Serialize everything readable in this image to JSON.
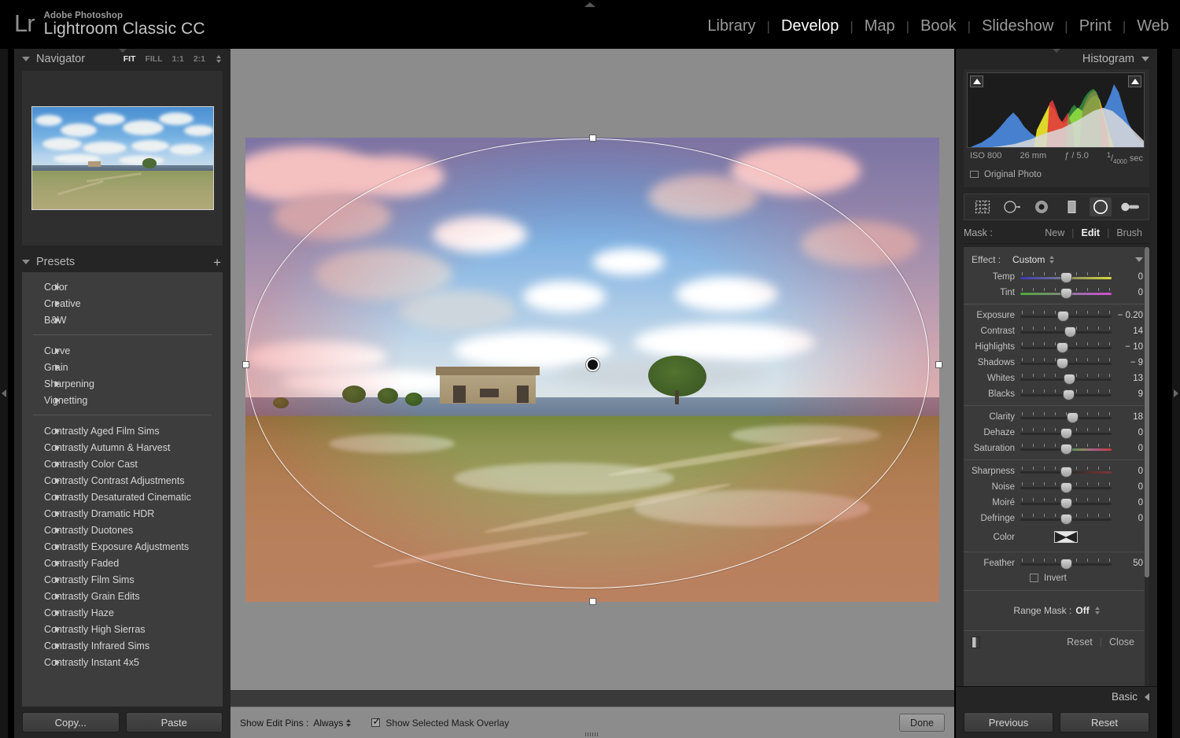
{
  "app": {
    "logo": "Lr",
    "brand_sub": "Adobe Photoshop",
    "brand_main": "Lightroom Classic CC"
  },
  "modules": [
    {
      "label": "Library",
      "active": false
    },
    {
      "label": "Develop",
      "active": true
    },
    {
      "label": "Map",
      "active": false
    },
    {
      "label": "Book",
      "active": false
    },
    {
      "label": "Slideshow",
      "active": false
    },
    {
      "label": "Print",
      "active": false
    },
    {
      "label": "Web",
      "active": false
    }
  ],
  "navigator": {
    "title": "Navigator",
    "zoom_levels": [
      {
        "label": "FIT",
        "active": true
      },
      {
        "label": "FILL",
        "active": false
      },
      {
        "label": "1:1",
        "active": false
      },
      {
        "label": "2:1",
        "active": false
      }
    ]
  },
  "presets": {
    "title": "Presets",
    "add_label": "+",
    "groups": [
      [
        "Color",
        "Creative",
        "B&W"
      ],
      [
        "Curve",
        "Grain",
        "Sharpening",
        "Vignetting"
      ],
      [
        "Contrastly Aged Film Sims",
        "Contrastly Autumn & Harvest",
        "Contrastly Color Cast",
        "Contrastly Contrast Adjustments",
        "Contrastly Desaturated Cinematic",
        "Contrastly Dramatic HDR",
        "Contrastly Duotones",
        "Contrastly Exposure Adjustments",
        "Contrastly Faded",
        "Contrastly Film Sims",
        "Contrastly Grain Edits",
        "Contrastly Haze",
        "Contrastly High Sierras",
        "Contrastly Infrared Sims",
        "Contrastly Instant 4x5"
      ]
    ]
  },
  "left_footer": {
    "copy_label": "Copy...",
    "paste_label": "Paste"
  },
  "toolbar": {
    "show_edit_pins_label": "Show Edit Pins :",
    "show_edit_pins_value": "Always",
    "mask_overlay_label": "Show Selected Mask Overlay",
    "mask_overlay_checked": true,
    "done_label": "Done"
  },
  "histogram": {
    "title": "Histogram",
    "iso": "ISO 800",
    "focal": "26 mm",
    "aperture": "ƒ / 5.0",
    "shutter_num": "1",
    "shutter_den": "4000",
    "shutter_unit": "sec",
    "original_photo_label": "Original Photo",
    "original_photo_checked": false
  },
  "tools": [
    {
      "name": "crop-overlay-tool",
      "selected": false
    },
    {
      "name": "spot-removal-tool",
      "selected": false
    },
    {
      "name": "red-eye-tool",
      "selected": false
    },
    {
      "name": "graduated-filter-tool",
      "selected": false
    },
    {
      "name": "radial-filter-tool",
      "selected": true
    },
    {
      "name": "adjustment-brush-tool",
      "selected": false
    }
  ],
  "mask": {
    "label": "Mask :",
    "new_label": "New",
    "edit_label": "Edit",
    "brush_label": "Brush",
    "active": "Edit"
  },
  "effect": {
    "label": "Effect :",
    "value": "Custom"
  },
  "sliders": [
    {
      "label": "Temp",
      "value": "0",
      "pos": 50,
      "grad": "grad-temp"
    },
    {
      "label": "Tint",
      "value": "0",
      "pos": 50,
      "grad": "grad-tint"
    },
    {
      "label": "Exposure",
      "value": "− 0.20",
      "pos": 47,
      "grad": ""
    },
    {
      "label": "Contrast",
      "value": "14",
      "pos": 55,
      "grad": ""
    },
    {
      "label": "Highlights",
      "value": "− 10",
      "pos": 46,
      "grad": ""
    },
    {
      "label": "Shadows",
      "value": "− 9",
      "pos": 46,
      "grad": ""
    },
    {
      "label": "Whites",
      "value": "13",
      "pos": 54,
      "grad": ""
    },
    {
      "label": "Blacks",
      "value": "9",
      "pos": 53,
      "grad": ""
    },
    {
      "label": "Clarity",
      "value": "18",
      "pos": 57,
      "grad": ""
    },
    {
      "label": "Dehaze",
      "value": "0",
      "pos": 50,
      "grad": ""
    },
    {
      "label": "Saturation",
      "value": "0",
      "pos": 50,
      "grad": "grad-sat"
    },
    {
      "label": "Sharpness",
      "value": "0",
      "pos": 50,
      "grad": "grad-sharp"
    },
    {
      "label": "Noise",
      "value": "0",
      "pos": 50,
      "grad": ""
    },
    {
      "label": "Moiré",
      "value": "0",
      "pos": 50,
      "grad": ""
    },
    {
      "label": "Defringe",
      "value": "0",
      "pos": 50,
      "grad": ""
    }
  ],
  "color_row": {
    "label": "Color"
  },
  "feather": {
    "label": "Feather",
    "value": "50",
    "pos": 50
  },
  "invert": {
    "label": "Invert",
    "checked": false
  },
  "range_mask": {
    "label": "Range Mask :",
    "value": "Off"
  },
  "panel_footer": {
    "reset_label": "Reset",
    "close_label": "Close"
  },
  "basic_row": {
    "label": "Basic"
  },
  "right_footer": {
    "previous_label": "Previous",
    "reset_label": "Reset"
  },
  "colors": {
    "panel_bg": "#252525",
    "slider_bg": "#3a3a3a",
    "canvas_bg": "#8c8c8c",
    "accent_text": "#ffffff",
    "mask_overlay": "#de3c3c"
  }
}
